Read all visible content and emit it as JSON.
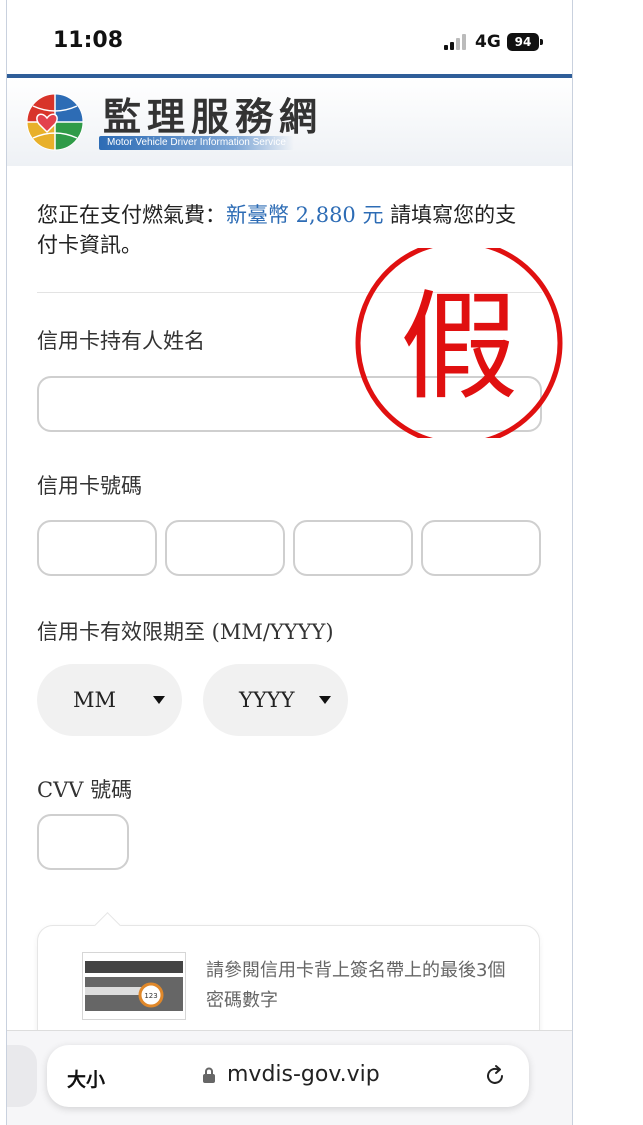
{
  "status_bar": {
    "time": "11:08",
    "network": "4G",
    "battery": "94"
  },
  "header": {
    "title": "監理服務網",
    "subtitle": "Motor Vehicle Driver Information Service"
  },
  "payment": {
    "intro_prefix": "您正在支付燃氣費：",
    "amount": "新臺幣 2,880 元",
    "intro_suffix": " 請填寫您的支付卡資訊。"
  },
  "form": {
    "cardholder_label": "信用卡持有人姓名",
    "cardholder_value": "",
    "card_number_label": "信用卡號碼",
    "card_number_groups": [
      "",
      "",
      "",
      ""
    ],
    "expiry_label": "信用卡有效限期至 (MM/YYYY)",
    "month_select": "MM",
    "year_select": "YYYY",
    "cvv_label": "CVV 號碼",
    "cvv_value": ""
  },
  "cvv_hint": {
    "card_code": "123",
    "text": "請參閱信用卡背上簽名帶上的最後3個密碼數字"
  },
  "stamp": {
    "text": "假",
    "color": "#e01010"
  },
  "browser": {
    "text_size": "大小",
    "url": "mvdis-gov.vip"
  },
  "colors": {
    "header_accent": "#2f5e99",
    "amount": "#2d6cb5"
  }
}
